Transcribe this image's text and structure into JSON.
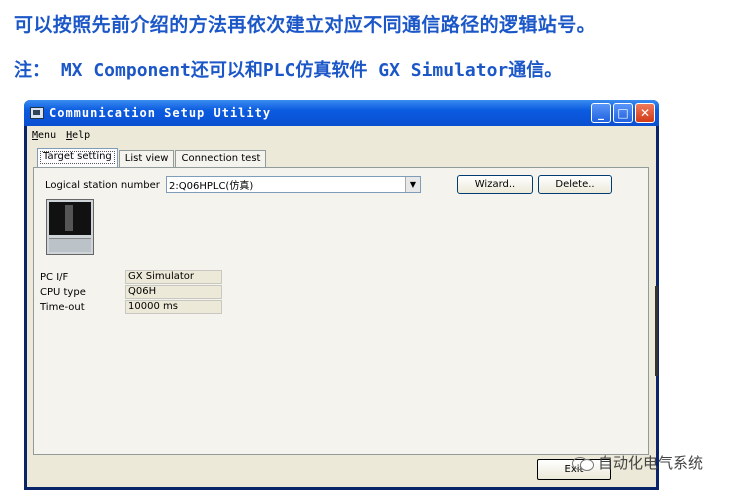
{
  "captions": {
    "line1": "可以按照先前介绍的方法再依次建立对应不同通信路径的逻辑站号。",
    "line2": "注： MX Component还可以和PLC仿真软件 GX Simulator通信。"
  },
  "window": {
    "title": "Communication Setup Utility",
    "controls": {
      "minimize": "_",
      "maximize": "□",
      "close": "✕"
    }
  },
  "menubar": {
    "menu_u": "M",
    "menu_rest": "enu",
    "help_u": "H",
    "help_rest": "elp"
  },
  "tabs": [
    "Target setting",
    "List view",
    "Connection test"
  ],
  "target_setting": {
    "logical_station_label": "Logical station number",
    "logical_station_value": "2:Q06HPLC(仿真)",
    "wizard_label": "Wizard..",
    "delete_label": "Delete..",
    "info": [
      {
        "label": "PC I/F",
        "value": "GX Simulator"
      },
      {
        "label": "CPU type",
        "value": "Q06H"
      },
      {
        "label": "Time-out",
        "value": "10000 ms"
      }
    ]
  },
  "exit_label": "Exit",
  "watermark": "自动化电气系统",
  "icons": {
    "app": "app-window-icon",
    "dropdown": "chevron-down-icon",
    "device": "plc-device-icon",
    "watermark": "wechat-icon"
  },
  "colors": {
    "caption": "#1c57c8",
    "titlebar": "#0b5be0",
    "client": "#ece9d8"
  }
}
